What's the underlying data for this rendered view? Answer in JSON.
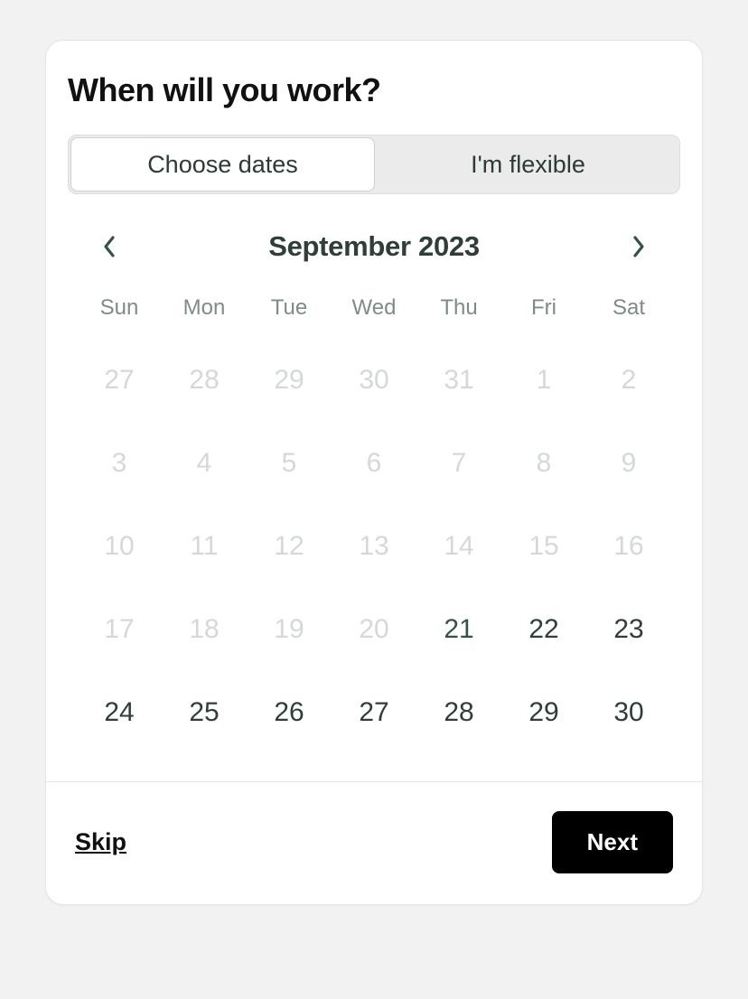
{
  "title": "When will you work?",
  "tabs": {
    "choose": "Choose dates",
    "flexible": "I'm flexible",
    "active": "choose"
  },
  "calendar": {
    "month_label": "September 2023",
    "weekdays": [
      "Sun",
      "Mon",
      "Tue",
      "Wed",
      "Thu",
      "Fri",
      "Sat"
    ],
    "days": [
      {
        "n": "27",
        "state": "disabled"
      },
      {
        "n": "28",
        "state": "disabled"
      },
      {
        "n": "29",
        "state": "disabled"
      },
      {
        "n": "30",
        "state": "disabled"
      },
      {
        "n": "31",
        "state": "disabled"
      },
      {
        "n": "1",
        "state": "disabled"
      },
      {
        "n": "2",
        "state": "disabled"
      },
      {
        "n": "3",
        "state": "disabled"
      },
      {
        "n": "4",
        "state": "disabled"
      },
      {
        "n": "5",
        "state": "disabled"
      },
      {
        "n": "6",
        "state": "disabled"
      },
      {
        "n": "7",
        "state": "disabled"
      },
      {
        "n": "8",
        "state": "disabled"
      },
      {
        "n": "9",
        "state": "disabled"
      },
      {
        "n": "10",
        "state": "disabled"
      },
      {
        "n": "11",
        "state": "disabled"
      },
      {
        "n": "12",
        "state": "disabled"
      },
      {
        "n": "13",
        "state": "disabled"
      },
      {
        "n": "14",
        "state": "disabled"
      },
      {
        "n": "15",
        "state": "disabled"
      },
      {
        "n": "16",
        "state": "disabled"
      },
      {
        "n": "17",
        "state": "disabled"
      },
      {
        "n": "18",
        "state": "disabled"
      },
      {
        "n": "19",
        "state": "disabled"
      },
      {
        "n": "20",
        "state": "disabled"
      },
      {
        "n": "21",
        "state": "today"
      },
      {
        "n": "22",
        "state": "normal"
      },
      {
        "n": "23",
        "state": "normal"
      },
      {
        "n": "24",
        "state": "normal"
      },
      {
        "n": "25",
        "state": "normal"
      },
      {
        "n": "26",
        "state": "normal"
      },
      {
        "n": "27",
        "state": "normal"
      },
      {
        "n": "28",
        "state": "normal"
      },
      {
        "n": "29",
        "state": "normal"
      },
      {
        "n": "30",
        "state": "normal"
      }
    ]
  },
  "footer": {
    "skip": "Skip",
    "next": "Next"
  }
}
